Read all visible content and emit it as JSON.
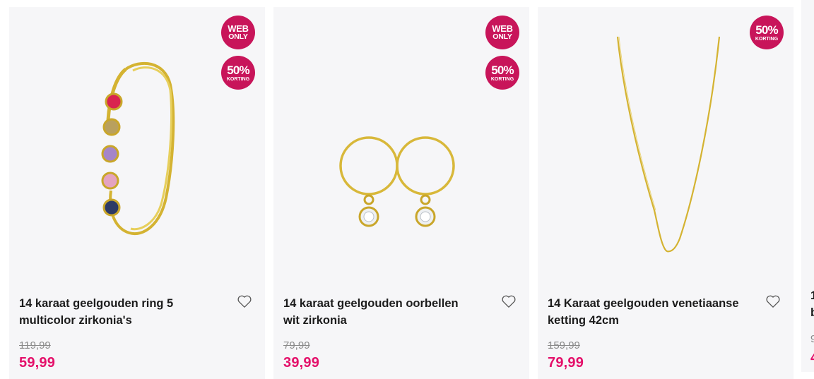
{
  "products": [
    {
      "title_line1": "14 karaat geelgouden ring 5",
      "title_line2": "multicolor zirkonia's",
      "old_price": "119,99",
      "price": "59,99",
      "badges": [
        {
          "line1": "WEB",
          "line2": "ONLY"
        },
        {
          "line1": "50%",
          "line2": "KORTING"
        }
      ],
      "image_icon": "ring-image"
    },
    {
      "title_line1": "14 karaat geelgouden oorbellen",
      "title_line2": "wit zirkonia",
      "old_price": "79,99",
      "price": "39,99",
      "badges": [
        {
          "line1": "WEB",
          "line2": "ONLY"
        },
        {
          "line1": "50%",
          "line2": "KORTING"
        }
      ],
      "image_icon": "earrings-image"
    },
    {
      "title_line1": "14 Karaat geelgouden venetiaanse",
      "title_line2": "ketting 42cm",
      "old_price": "159,99",
      "price": "79,99",
      "badges": [
        {
          "line1": "50%",
          "line2": "KORTING"
        }
      ],
      "image_icon": "necklace-image"
    }
  ],
  "partial_card": {
    "title_line1": "1",
    "title_line2": "b",
    "old_price": "9",
    "price": "4"
  },
  "colors": {
    "badge": "#c8155a",
    "price": "#e4106a",
    "card_bg": "#f6f6f8",
    "gold": "#d8b83a"
  },
  "icons": {
    "wishlist": "heart-outline-icon"
  }
}
